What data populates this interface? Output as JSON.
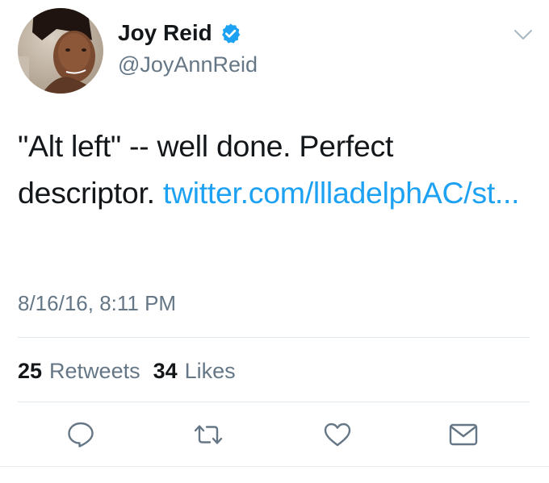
{
  "user": {
    "display_name": "Joy Reid",
    "handle": "@JoyAnnReid",
    "verified": true,
    "verified_icon": "verified-badge-icon"
  },
  "tweet": {
    "text": "\"Alt left\" -- well done. Perfect descriptor. ",
    "link_text": "twitter.com/llladelphAC/st...",
    "timestamp": "8/16/16, 8:11 PM"
  },
  "stats": {
    "retweets_count": "25",
    "retweets_label": "Retweets",
    "likes_count": "34",
    "likes_label": "Likes"
  },
  "actions": {
    "reply_icon": "reply-icon",
    "retweet_icon": "retweet-icon",
    "like_icon": "heart-icon",
    "dm_icon": "envelope-icon"
  },
  "colors": {
    "link": "#1da1f2",
    "secondary_text": "#657786",
    "primary_text": "#14171a",
    "verified": "#1da1f2",
    "divider": "#e1e8ed"
  }
}
